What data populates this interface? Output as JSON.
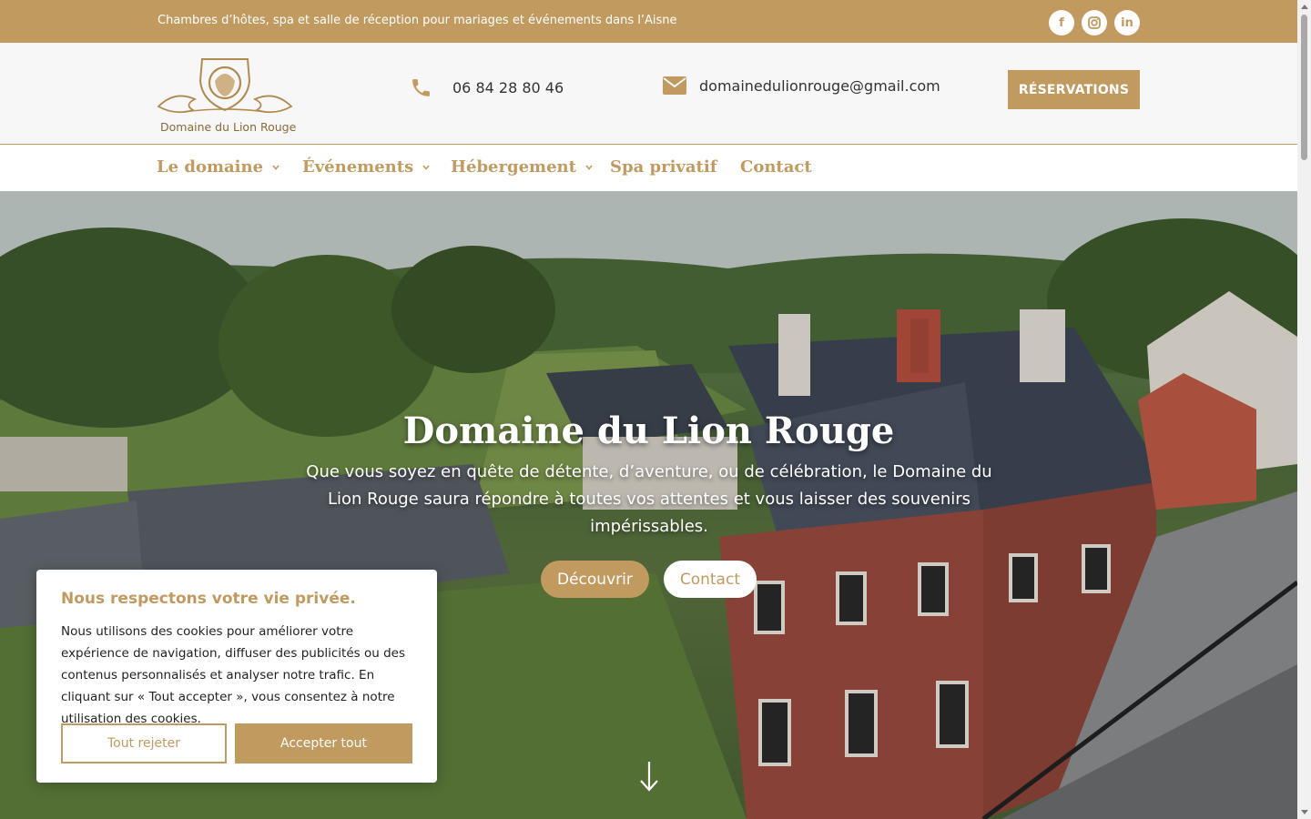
{
  "topbar": {
    "tagline": "Chambres d’hôtes, spa et salle de réception pour mariages et événements dans l’Aisne",
    "socials": [
      {
        "icon": "facebook-icon",
        "glyph": "f"
      },
      {
        "icon": "instagram-icon",
        "glyph": "◎"
      },
      {
        "icon": "linkedin-icon",
        "glyph": "in"
      }
    ]
  },
  "header": {
    "logo_text": "Domaine du Lion Rouge",
    "phone": "06 84 28 80 46",
    "email": "domainedulionrouge@gmail.com",
    "reserve_label": "RÉSERVATIONS"
  },
  "nav": {
    "items": [
      {
        "label": "Le domaine",
        "has_dropdown": true
      },
      {
        "label": "Événements",
        "has_dropdown": true
      },
      {
        "label": "Hébergement",
        "has_dropdown": true
      },
      {
        "label": "Spa privatif",
        "has_dropdown": false
      },
      {
        "label": "Contact",
        "has_dropdown": false
      }
    ]
  },
  "hero": {
    "title": "Domaine du Lion Rouge",
    "subtitle": "Que vous soyez en quête de détente, d’aventure, ou de célébration, le Domaine du Lion Rouge saura répondre à toutes vos attentes et vous laisser des souvenirs impérissables.",
    "primary_button": "Découvrir",
    "secondary_button": "Contact"
  },
  "cookie": {
    "title": "Nous respectons votre vie privée.",
    "text": "Nous utilisons des cookies pour améliorer votre expérience de navigation, diffuser des publicités ou des contenus personnalisés et analyser notre trafic. En cliquant sur « Tout accepter », vous consentez à notre utilisation des cookies.",
    "reject_label": "Tout rejeter",
    "accept_label": "Accepter tout"
  },
  "colors": {
    "accent": "#c19a5f",
    "text": "#333333"
  }
}
